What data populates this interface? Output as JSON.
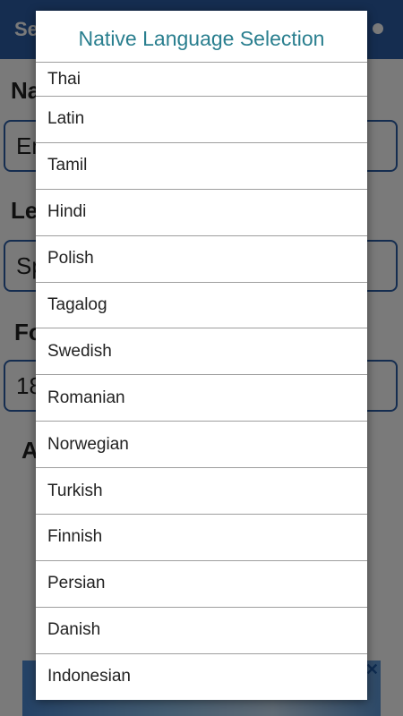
{
  "background": {
    "appbar_title": "Se",
    "labels": [
      "Na",
      "Le",
      "Fo",
      "A"
    ],
    "fields": [
      "En",
      "Sp",
      "18"
    ]
  },
  "dialog": {
    "title": "Native Language Selection",
    "items": [
      "Thai",
      "Latin",
      "Tamil",
      "Hindi",
      "Polish",
      "Tagalog",
      "Swedish",
      "Romanian",
      "Norwegian",
      "Turkish",
      "Finnish",
      "Persian",
      "Danish",
      "Indonesian"
    ]
  },
  "ad": {
    "close_label": "✕"
  },
  "colors": {
    "accent": "#2a7f8f",
    "appbar": "#2d5fa8"
  }
}
